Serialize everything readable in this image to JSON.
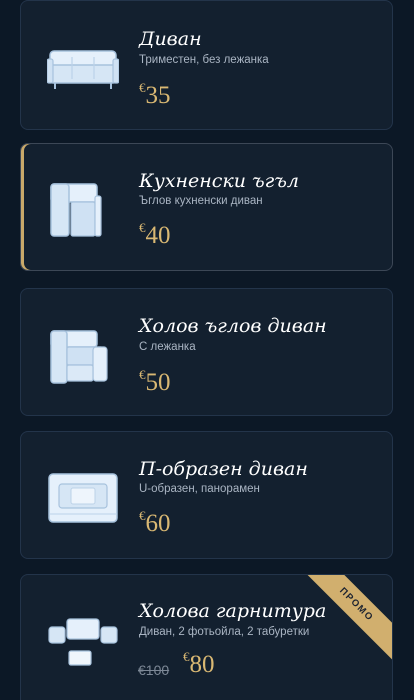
{
  "products": [
    {
      "title": "Диван",
      "subtitle": "Триместен, без лежанка",
      "currency": "€",
      "price": "35",
      "icon": "sofa-icon"
    },
    {
      "title": "Кухненски ъгъл",
      "subtitle": "Ъглов кухненски диван",
      "currency": "€",
      "price": "40",
      "icon": "kitchen-corner-icon"
    },
    {
      "title": "Холов ъглов диван",
      "subtitle": "С лежанка",
      "currency": "€",
      "price": "50",
      "icon": "corner-sofa-icon"
    },
    {
      "title": "П-образен диван",
      "subtitle": "U-образен, панорамен",
      "currency": "€",
      "price": "60",
      "icon": "u-shaped-sofa-icon"
    },
    {
      "title": "Холова гарнитура",
      "subtitle": "Диван, 2 фотьойла, 2 табуретки",
      "currency": "€",
      "price": "80",
      "old_price": "€100",
      "badge": "ПРОМО",
      "icon": "living-room-set-icon"
    }
  ],
  "colors": {
    "background": "#0c1826",
    "card": "#13202f",
    "accent": "#d9b873",
    "badge": "#d1af6e"
  }
}
